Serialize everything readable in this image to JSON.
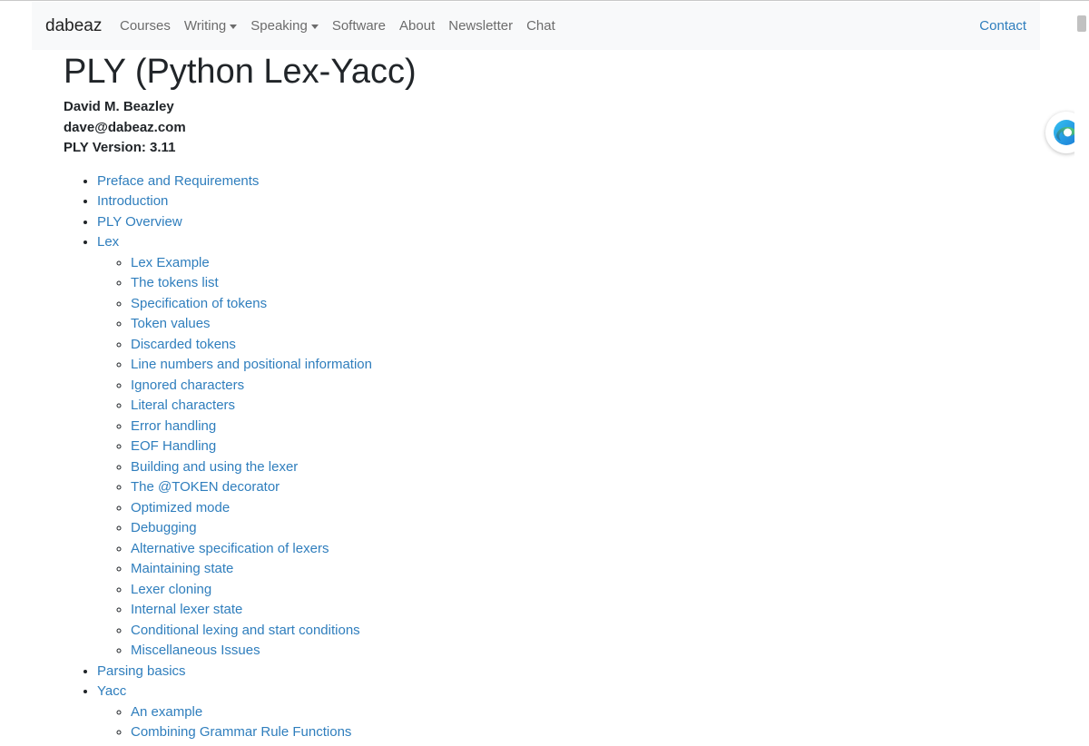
{
  "navbar": {
    "brand": "dabeaz",
    "links": [
      {
        "label": "Courses",
        "dropdown": false
      },
      {
        "label": "Writing",
        "dropdown": true
      },
      {
        "label": "Speaking",
        "dropdown": true
      },
      {
        "label": "Software",
        "dropdown": false
      },
      {
        "label": "About",
        "dropdown": false
      },
      {
        "label": "Newsletter",
        "dropdown": false
      },
      {
        "label": "Chat",
        "dropdown": false
      }
    ],
    "contact": "Contact"
  },
  "page": {
    "title": "PLY (Python Lex-Yacc)",
    "author": "David M. Beazley",
    "email": "dave@dabeaz.com",
    "version": "PLY Version: 3.11"
  },
  "toc": [
    {
      "label": "Preface and Requirements",
      "children": []
    },
    {
      "label": "Introduction",
      "children": []
    },
    {
      "label": "PLY Overview",
      "children": []
    },
    {
      "label": "Lex",
      "children": [
        "Lex Example",
        "The tokens list",
        "Specification of tokens",
        "Token values",
        "Discarded tokens",
        "Line numbers and positional information",
        "Ignored characters",
        "Literal characters",
        "Error handling",
        "EOF Handling",
        "Building and using the lexer",
        "The @TOKEN decorator",
        "Optimized mode",
        "Debugging",
        "Alternative specification of lexers",
        "Maintaining state",
        "Lexer cloning",
        "Internal lexer state",
        "Conditional lexing and start conditions",
        "Miscellaneous Issues"
      ]
    },
    {
      "label": "Parsing basics",
      "children": []
    },
    {
      "label": "Yacc",
      "children": [
        "An example",
        "Combining Grammar Rule Functions"
      ]
    }
  ],
  "colors": {
    "link": "#2f7ebd",
    "navbar_bg": "#f8f9fa",
    "nav_text": "#6c6c6c"
  },
  "icons": {
    "edge": "edge-browser-icon",
    "caret": "caret-down-icon"
  }
}
